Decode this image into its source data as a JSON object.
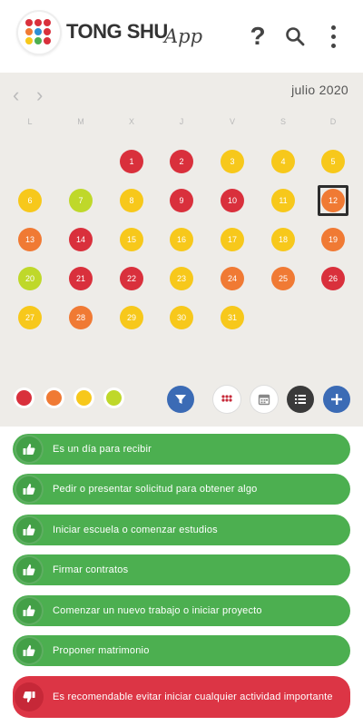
{
  "header": {
    "brand": "TONG SHU",
    "brand_suffix": "App",
    "help_label": "?",
    "icons": [
      "logo-dots",
      "help-icon",
      "search-icon",
      "more-vert-icon"
    ]
  },
  "calendar": {
    "month_label": "julio 2020",
    "prev_label": "‹",
    "next_label": "›",
    "weekdays": [
      "L",
      "M",
      "X",
      "J",
      "V",
      "S",
      "D"
    ],
    "selected_day": 12,
    "colors": {
      "red": "#d9303c",
      "orange": "#f07a34",
      "yellow": "#f7c81b",
      "lime": "#bfd82a"
    },
    "days": [
      {
        "label": "1",
        "color": "red"
      },
      {
        "label": "2",
        "color": "red"
      },
      {
        "label": "3",
        "color": "yellow"
      },
      {
        "label": "4",
        "color": "yellow"
      },
      {
        "label": "5",
        "color": "yellow"
      },
      {
        "label": "6",
        "color": "yellow"
      },
      {
        "label": "7",
        "color": "lime"
      },
      {
        "label": "8",
        "color": "yellow"
      },
      {
        "label": "9",
        "color": "red"
      },
      {
        "label": "10",
        "color": "red"
      },
      {
        "label": "11",
        "color": "yellow"
      },
      {
        "label": "12",
        "color": "orange"
      },
      {
        "label": "13",
        "color": "orange"
      },
      {
        "label": "14",
        "color": "red"
      },
      {
        "label": "15",
        "color": "yellow"
      },
      {
        "label": "16",
        "color": "yellow"
      },
      {
        "label": "17",
        "color": "yellow"
      },
      {
        "label": "18",
        "color": "yellow"
      },
      {
        "label": "19",
        "color": "orange"
      },
      {
        "label": "20",
        "color": "lime"
      },
      {
        "label": "21",
        "color": "red"
      },
      {
        "label": "22",
        "color": "red"
      },
      {
        "label": "23",
        "color": "yellow"
      },
      {
        "label": "24",
        "color": "orange"
      },
      {
        "label": "25",
        "color": "orange"
      },
      {
        "label": "26",
        "color": "red"
      },
      {
        "label": "27",
        "color": "yellow"
      },
      {
        "label": "28",
        "color": "orange"
      },
      {
        "label": "29",
        "color": "yellow"
      },
      {
        "label": "30",
        "color": "yellow"
      },
      {
        "label": "31",
        "color": "yellow"
      }
    ],
    "legend": [
      "red",
      "orange",
      "yellow",
      "lime"
    ],
    "toolbar": [
      {
        "name": "filter-button",
        "icon": "filter-icon",
        "bg": "#3b6bb5"
      },
      {
        "name": "grid-view-button",
        "icon": "grid-icon",
        "bg": "#ffffff"
      },
      {
        "name": "calendar-view-button",
        "icon": "calendar-icon",
        "bg": "#ffffff"
      },
      {
        "name": "list-view-button",
        "icon": "list-icon",
        "bg": "#3a3a3a"
      },
      {
        "name": "add-button",
        "icon": "plus-icon",
        "bg": "#3b6bb5"
      }
    ]
  },
  "activities": [
    {
      "text": "Es un día para recibir",
      "type": "good"
    },
    {
      "text": "Pedir o presentar solicitud para obtener algo",
      "type": "good"
    },
    {
      "text": "Iniciar escuela o comenzar estudios",
      "type": "good"
    },
    {
      "text": "Firmar contratos",
      "type": "good"
    },
    {
      "text": "Comenzar un nuevo trabajo o iniciar proyecto",
      "type": "good"
    },
    {
      "text": "Proponer matrimonio",
      "type": "good"
    },
    {
      "text": "Es recomendable evitar iniciar cualquier actividad importante",
      "type": "bad"
    }
  ]
}
